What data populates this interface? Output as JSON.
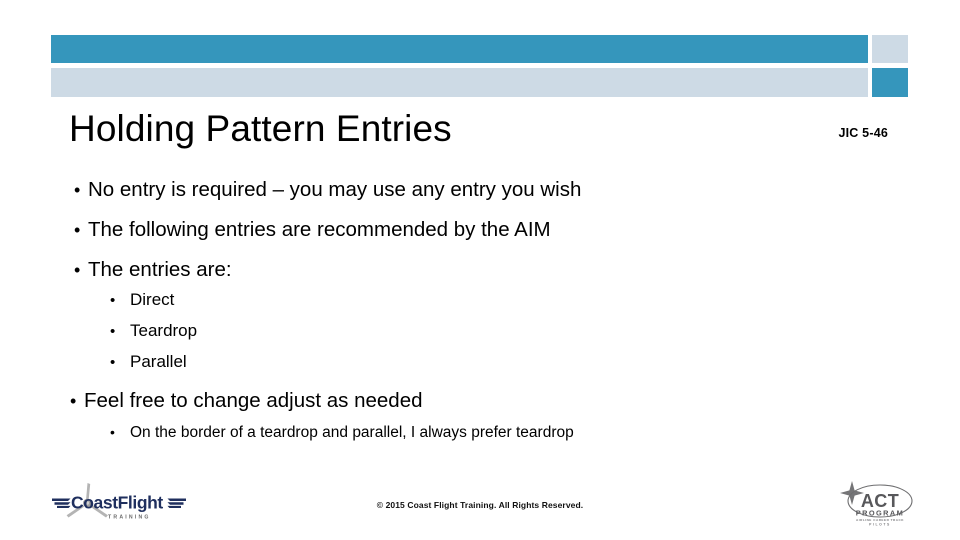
{
  "slide": {
    "title": "Holding Pattern Entries",
    "reference_code": "JIC 5-46",
    "bullets": [
      {
        "level": 1,
        "marker": "•",
        "text": "No entry is required – you may use any entry you wish"
      },
      {
        "level": 1,
        "marker": "•",
        "text": "The following entries are recommended by the AIM"
      },
      {
        "level": 1,
        "marker": "•",
        "text": "The entries are:"
      },
      {
        "level": 2,
        "marker": "•",
        "text": "Direct"
      },
      {
        "level": 2,
        "marker": "•",
        "text": "Teardrop"
      },
      {
        "level": 2,
        "marker": "•",
        "text": "Parallel"
      },
      {
        "level": 1,
        "marker": "•",
        "text": "Feel free to change adjust as needed"
      },
      {
        "level": 2,
        "marker": "•",
        "text": "On the border of a teardrop and parallel, I always prefer teardrop"
      }
    ]
  },
  "footer": {
    "copyright": "© 2015 Coast Flight Training. All Rights Reserved.",
    "left_logo": {
      "name": "coastflight-logo",
      "primary_text": "CoastFlight",
      "secondary_text": "T R A I N I N G"
    },
    "right_logo": {
      "name": "act-program-logo",
      "primary_text": "ACT",
      "secondary_text": "PROGRAM",
      "tertiary_text": "AIRLINE CAREER TRACK",
      "quaternary_text": "PILOTS"
    }
  },
  "theme": {
    "accent_dark": "#3596bc",
    "accent_light": "#cddae5",
    "background": "#ffffff",
    "text": "#000000",
    "logo_navy": "#1f2f5e",
    "logo_gray": "#9b9b9b",
    "act_gray": "#58585b"
  }
}
